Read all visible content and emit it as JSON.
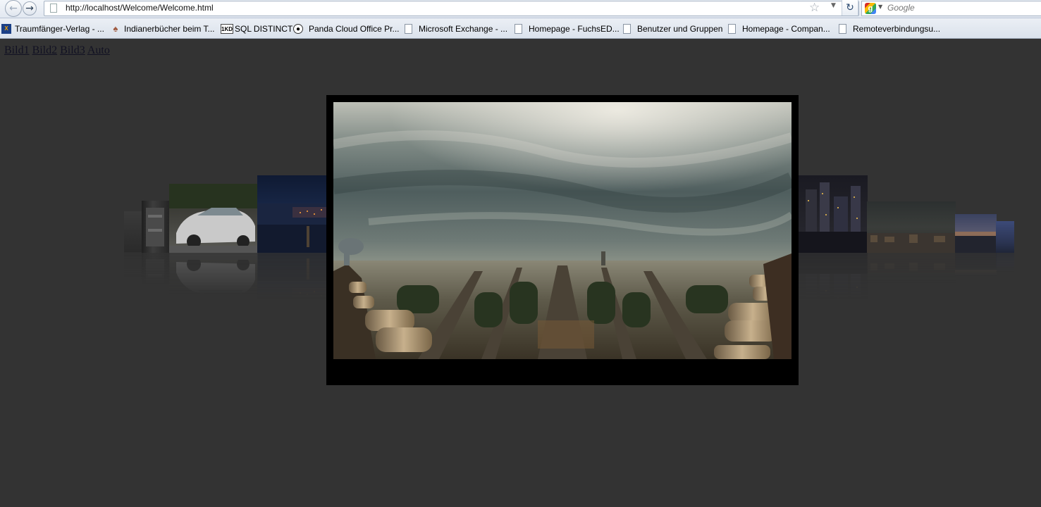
{
  "browser": {
    "url": "http://localhost/Welcome/Welcome.html",
    "search_placeholder": "Google",
    "icons": {
      "back": "back-arrow-icon",
      "forward": "forward-arrow-icon",
      "bookmark_star": "star-icon",
      "reload": "reload-icon",
      "search_engine": "google-icon"
    }
  },
  "bookmarks": [
    {
      "label": "Traumfänger-Verlag - ...",
      "icon": "traumfaenger-icon"
    },
    {
      "label": "Indianerbücher beim T...",
      "icon": "feather-icon"
    },
    {
      "label": "SQL DISTINCT",
      "icon": "1kd-icon"
    },
    {
      "label": "Panda Cloud Office Pr...",
      "icon": "panda-icon"
    },
    {
      "label": "Microsoft Exchange - ...",
      "icon": "page-icon"
    },
    {
      "label": "Homepage - FuchsED...",
      "icon": "page-icon"
    },
    {
      "label": "Benutzer und Gruppen",
      "icon": "page-icon"
    },
    {
      "label": "Homepage - Compan...",
      "icon": "page-icon"
    },
    {
      "label": "Remoteverbindungsu...",
      "icon": "page-icon"
    }
  ],
  "page": {
    "links": [
      "Bild1",
      "Bild2",
      "Bild3",
      "Auto"
    ],
    "background": "#333333",
    "frame_color": "#000000"
  }
}
